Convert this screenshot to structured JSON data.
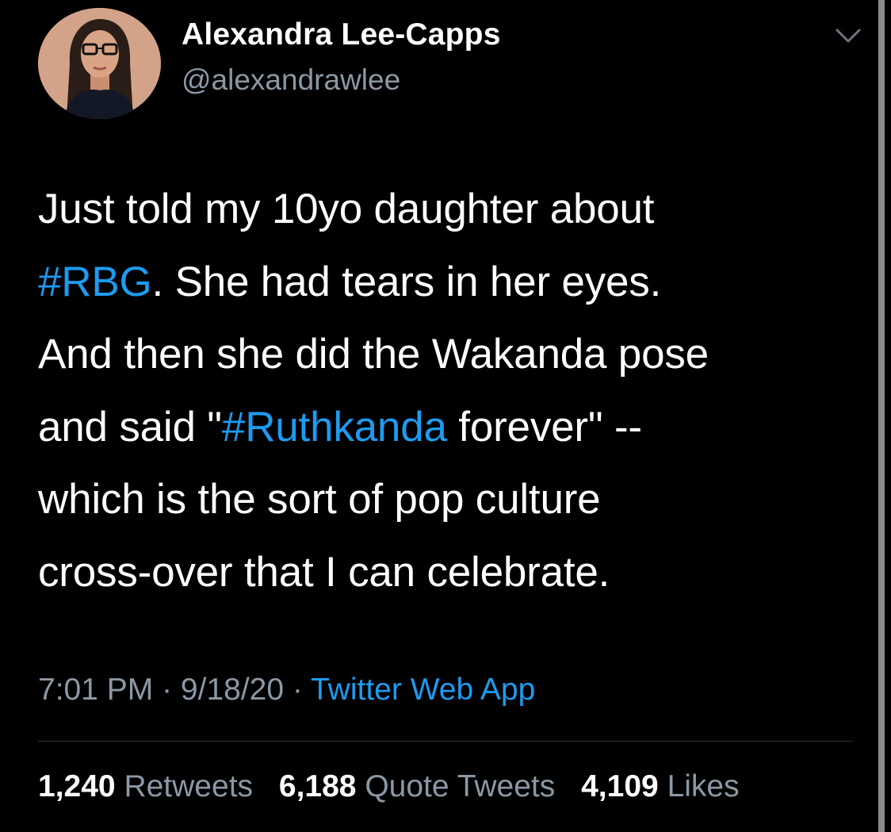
{
  "author": {
    "name": "Alexandra Lee-Capps",
    "handle": "@alexandrawlee"
  },
  "tweet": {
    "line1": "Just told my 10yo daughter about",
    "line2_hashtag": "#RBG",
    "line2_rest": ". She had tears in her eyes.",
    "line3": "And then she did the Wakanda pose",
    "line4_start": "and said \"",
    "line4_hashtag": "#Ruthkanda",
    "line4_end": " forever\" --",
    "line5": "which is the sort of pop culture",
    "line6": "cross-over that I can celebrate."
  },
  "meta": {
    "time": "7:01 PM",
    "sep1": " · ",
    "date": "9/18/20",
    "sep2": " · ",
    "source": "Twitter Web App"
  },
  "stats": {
    "retweets_count": "1,240",
    "retweets_label": "Retweets",
    "quotes_count": "6,188",
    "quotes_label": "Quote Tweets",
    "likes_count": "4,109",
    "likes_label": "Likes"
  },
  "icons": {
    "menu": "chevron-down-icon",
    "avatar": "avatar"
  },
  "colors": {
    "background": "#000000",
    "text": "#ffffff",
    "secondary": "#8b98a5",
    "link": "#1d9bf0",
    "divider": "#2f3336"
  }
}
